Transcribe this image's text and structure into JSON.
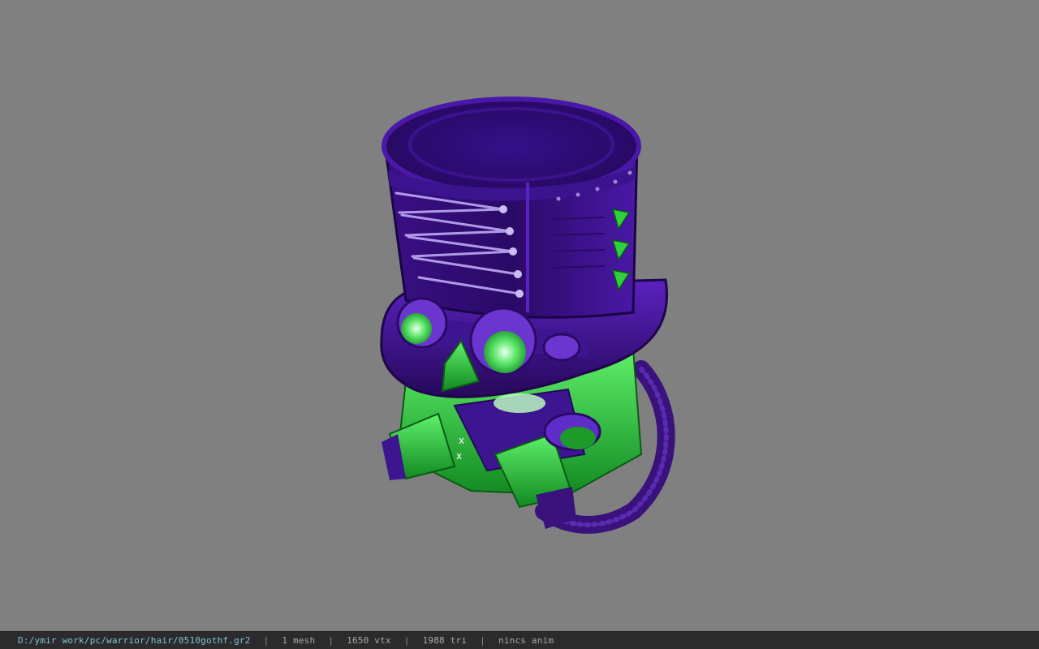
{
  "viewer": {
    "background_color": "#808080",
    "model_colors": {
      "purple_dark": "#2a0a5e",
      "purple_mid": "#4b16a6",
      "purple_light": "#7a4ae0",
      "green_dark": "#0f6b1a",
      "green_mid": "#23b32f",
      "green_light": "#8ef58f"
    }
  },
  "status_bar": {
    "file_path": "D:/ymir work/pc/warrior/hair/0510gothf.gr2",
    "separator": "|",
    "mesh_count": "1 mesh",
    "vertex_count": "1650 vtx",
    "triangle_count": "1988 tri",
    "animation": "nincs anim"
  }
}
